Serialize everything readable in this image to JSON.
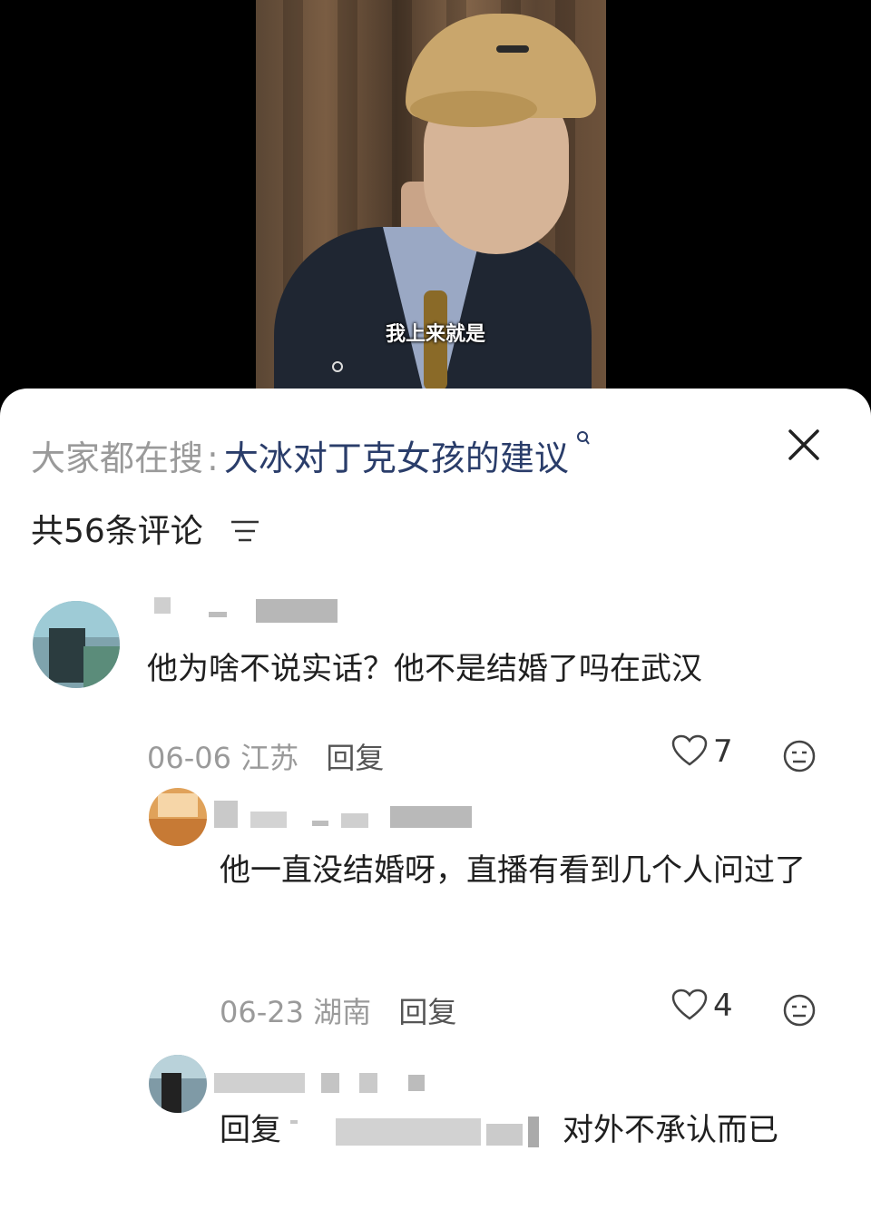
{
  "video": {
    "subtitle": "我上来就是"
  },
  "search": {
    "prefix": "大家都在搜",
    "separator": ":",
    "term": "大冰对丁克女孩的建议"
  },
  "comments_header": {
    "count_label": "共56条评论"
  },
  "comments": [
    {
      "text": "他为啥不说实话？他不是结婚了吗在武汉",
      "date": "06-06",
      "location": "江苏",
      "reply_label": "回复",
      "likes": "7"
    },
    {
      "text": "他一直没结婚呀，直播有看到几个人问过了",
      "date": "06-23",
      "location": "湖南",
      "reply_label": "回复",
      "likes": "4"
    },
    {
      "reply_prefix": "回复",
      "text_suffix": "对外不承认而已"
    }
  ],
  "icons": {
    "close": "close-icon",
    "filter": "filter-icon",
    "heart": "heart-icon",
    "dislike": "dislike-face-icon",
    "search": "search-icon"
  }
}
